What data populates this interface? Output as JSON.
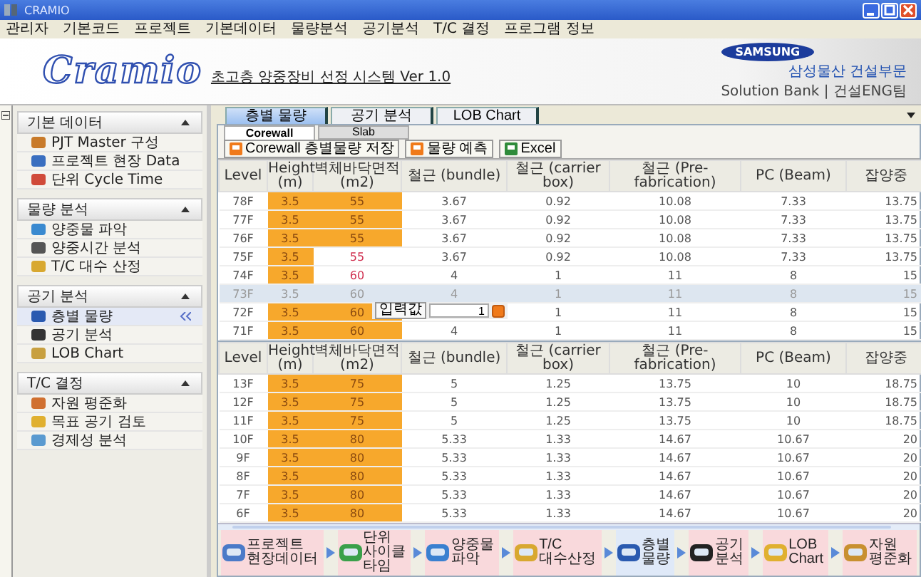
{
  "window": {
    "title": "CRAMIO"
  },
  "menu": [
    "관리자",
    "기본코드",
    "프로젝트",
    "기본데이터",
    "물량분석",
    "공기분석",
    "T/C 결정",
    "프로그램 정보"
  ],
  "header": {
    "logo": "Cramio",
    "subtitle": "초고층 양중장비 선정 시스템  Ver 1.0",
    "brand": "SAMSUNG",
    "company": "삼성물산 건설부문",
    "tagline": "Solution Bank | 건설ENG팀"
  },
  "sidebar": [
    {
      "title": "기본 데이터",
      "expanded": true,
      "items": [
        {
          "label": "PJT Master 구성",
          "selected": false
        },
        {
          "label": "프로젝트 현장 Data",
          "selected": false
        },
        {
          "label": "단위 Cycle Time",
          "selected": false
        }
      ]
    },
    {
      "title": "물량 분석",
      "expanded": true,
      "items": [
        {
          "label": "양중물 파악",
          "selected": false
        },
        {
          "label": "양중시간 분석",
          "selected": false
        },
        {
          "label": "T/C 대수 산정",
          "selected": false
        }
      ]
    },
    {
      "title": "공기 분석",
      "expanded": true,
      "items": [
        {
          "label": "층별 물량",
          "selected": true
        },
        {
          "label": "공기 분석",
          "selected": false
        },
        {
          "label": "LOB Chart",
          "selected": false
        }
      ]
    },
    {
      "title": "T/C 결정",
      "expanded": true,
      "items": [
        {
          "label": "자원 평준화",
          "selected": false
        },
        {
          "label": "목표 공기 검토",
          "selected": false
        },
        {
          "label": "경제성 분석",
          "selected": false
        }
      ]
    }
  ],
  "tabs": [
    {
      "label": "층별 물량",
      "selected": true
    },
    {
      "label": "공기 분석",
      "selected": false
    },
    {
      "label": "LOB Chart",
      "selected": false
    }
  ],
  "subtabs": [
    {
      "label": "Corewall",
      "selected": true
    },
    {
      "label": "Slab",
      "selected": false
    }
  ],
  "toolbar": [
    "Corewall 층별물량 저장",
    "물량 예측",
    "Excel"
  ],
  "upper_columns": [
    {
      "label": "Level"
    },
    {
      "label": "Height",
      "unit": "(m)"
    },
    {
      "label": "벽체바닥면적",
      "unit": "(m2)"
    },
    {
      "label": "철근 (bundle)"
    },
    {
      "label": "철근 (carrier box)"
    },
    {
      "label": "철근 (Pre-fabrication)"
    },
    {
      "label": "PC (Beam)"
    },
    {
      "label": "잡양중"
    }
  ],
  "lower_columns": [
    {
      "label": "Level"
    },
    {
      "label": "Height",
      "unit": "(m)"
    },
    {
      "label": "벽체바닥면적",
      "unit": "(m2)"
    },
    {
      "label": "철근 (bundle)"
    },
    {
      "label": "철근 (carrier box)"
    },
    {
      "label": "철근 (Pre-fabrication)"
    },
    {
      "label": "PC (Beam)"
    },
    {
      "label": "잡양중"
    }
  ],
  "upper_rows": [
    {
      "cells": [
        "78F",
        "3.5",
        "55",
        "3.67",
        "0.92",
        "10.08",
        "7.33",
        "13.75"
      ],
      "height_highlight": true,
      "area_highlight": true,
      "area_alert": false,
      "selected": false
    },
    {
      "cells": [
        "77F",
        "3.5",
        "55",
        "3.67",
        "0.92",
        "10.08",
        "7.33",
        "13.75"
      ],
      "height_highlight": true,
      "area_highlight": true,
      "area_alert": false,
      "selected": false
    },
    {
      "cells": [
        "76F",
        "3.5",
        "55",
        "3.67",
        "0.92",
        "10.08",
        "7.33",
        "13.75"
      ],
      "height_highlight": true,
      "area_highlight": true,
      "area_alert": false,
      "selected": false
    },
    {
      "cells": [
        "75F",
        "3.5",
        "55",
        "3.67",
        "0.92",
        "10.08",
        "7.33",
        "13.75"
      ],
      "height_highlight": true,
      "area_highlight": false,
      "area_alert": true,
      "selected": false
    },
    {
      "cells": [
        "74F",
        "3.5",
        "60",
        "4",
        "1",
        "11",
        "8",
        "15"
      ],
      "height_highlight": true,
      "area_highlight": false,
      "area_alert": true,
      "selected": false
    },
    {
      "cells": [
        "73F",
        "3.5",
        "60",
        "4",
        "1",
        "11",
        "8",
        "15"
      ],
      "height_highlight": false,
      "area_highlight": false,
      "area_alert": false,
      "selected": true
    },
    {
      "cells": [
        "72F",
        "3.5",
        "60",
        "",
        "1",
        "11",
        "8",
        "15"
      ],
      "height_highlight": true,
      "area_highlight": true,
      "area_alert": false,
      "selected": false
    },
    {
      "cells": [
        "71F",
        "3.5",
        "60",
        "4",
        "1",
        "11",
        "8",
        "15"
      ],
      "height_highlight": true,
      "area_highlight": true,
      "area_alert": false,
      "selected": false
    }
  ],
  "popup": {
    "label": "입력값",
    "value": "1"
  },
  "lower_rows": [
    {
      "cells": [
        "13F",
        "3.5",
        "75",
        "5",
        "1.25",
        "13.75",
        "10",
        "18.75"
      ],
      "height_highlight": true,
      "area_highlight": true,
      "area_alert": false,
      "selected": false
    },
    {
      "cells": [
        "12F",
        "3.5",
        "75",
        "5",
        "1.25",
        "13.75",
        "10",
        "18.75"
      ],
      "height_highlight": true,
      "area_highlight": true,
      "area_alert": false,
      "selected": false
    },
    {
      "cells": [
        "11F",
        "3.5",
        "75",
        "5",
        "1.25",
        "13.75",
        "10",
        "18.75"
      ],
      "height_highlight": true,
      "area_highlight": true,
      "area_alert": false,
      "selected": false
    },
    {
      "cells": [
        "10F",
        "3.5",
        "80",
        "5.33",
        "1.33",
        "14.67",
        "10.67",
        "20"
      ],
      "height_highlight": true,
      "area_highlight": true,
      "area_alert": false,
      "selected": false
    },
    {
      "cells": [
        "9F",
        "3.5",
        "80",
        "5.33",
        "1.33",
        "14.67",
        "10.67",
        "20"
      ],
      "height_highlight": true,
      "area_highlight": true,
      "area_alert": false,
      "selected": false
    },
    {
      "cells": [
        "8F",
        "3.5",
        "80",
        "5.33",
        "1.33",
        "14.67",
        "10.67",
        "20"
      ],
      "height_highlight": true,
      "area_highlight": true,
      "area_alert": false,
      "selected": false
    },
    {
      "cells": [
        "7F",
        "3.5",
        "80",
        "5.33",
        "1.33",
        "14.67",
        "10.67",
        "20"
      ],
      "height_highlight": true,
      "area_highlight": true,
      "area_alert": false,
      "selected": false
    },
    {
      "cells": [
        "6F",
        "3.5",
        "80",
        "5.33",
        "1.33",
        "14.67",
        "10.67",
        "20"
      ],
      "height_highlight": true,
      "area_highlight": true,
      "area_alert": false,
      "selected": false
    }
  ],
  "flow": [
    {
      "label": "프로젝트 현장데이터",
      "selected": false
    },
    {
      "label": "단위 사이클 타임",
      "selected": false
    },
    {
      "label": "양중물 파악",
      "selected": false
    },
    {
      "label": "T/C 대수산정",
      "selected": false
    },
    {
      "label": "층별 물량",
      "selected": true
    },
    {
      "label": "공기 분석",
      "selected": false
    },
    {
      "label": "LOB Chart",
      "selected": false
    },
    {
      "label": "자원 평준화",
      "selected": false
    }
  ]
}
